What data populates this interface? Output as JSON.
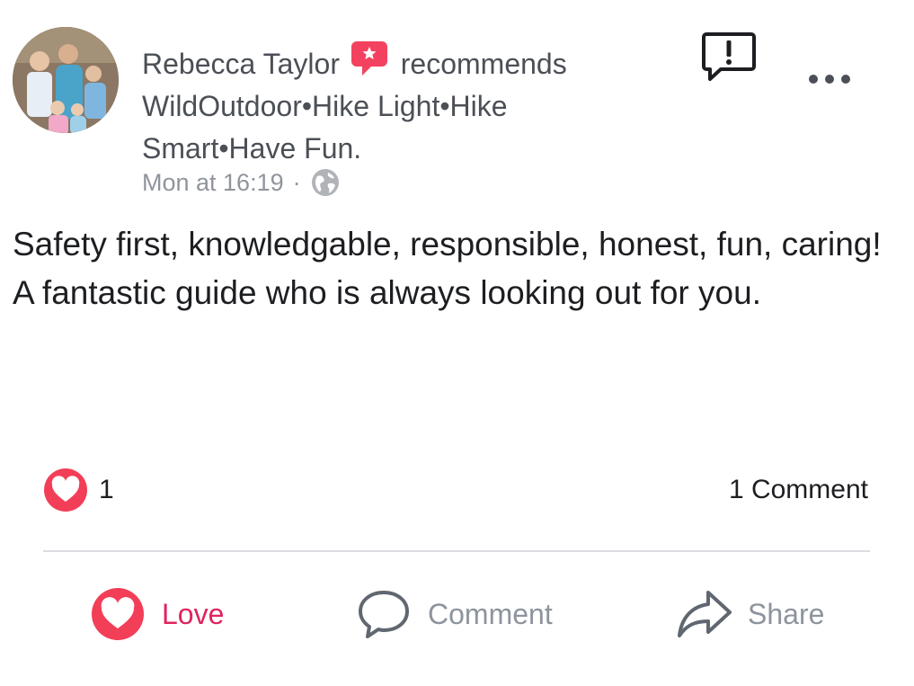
{
  "post": {
    "author": "Rebecca Taylor",
    "verb": "recommends",
    "page_name": "WildOutdoor•Hike Light•Hike Smart•Have Fun.",
    "timestamp": "Mon at 16:19",
    "separator": "·",
    "privacy_icon": "globe-icon",
    "body": "Safety first, knowledgable, responsible, honest, fun, caring! A fantastic guide who is always looking out for you."
  },
  "stats": {
    "reaction_icon": "love-reaction-icon",
    "reaction_count": "1",
    "comment_count_label": "1 Comment"
  },
  "actions": {
    "love_label": "Love",
    "comment_label": "Comment",
    "share_label": "Share"
  },
  "colors": {
    "love": "#e0245e",
    "muted": "#8d949e",
    "recommend_badge": "#f3425f"
  }
}
